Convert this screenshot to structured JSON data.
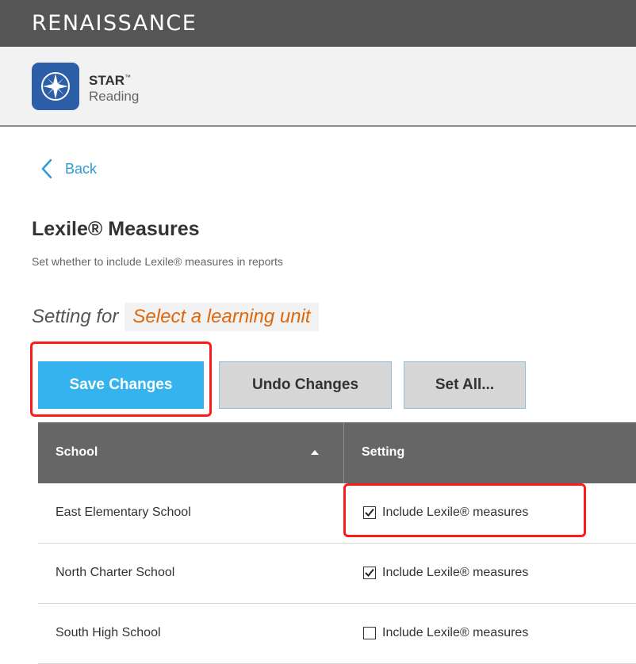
{
  "header": {
    "brand": "RENAISSANCE"
  },
  "app": {
    "name": "STAR",
    "trademark": "™",
    "subtitle": "Reading"
  },
  "nav": {
    "back_label": "Back"
  },
  "page": {
    "title": "Lexile® Measures",
    "description": "Set whether to include Lexile® measures in reports",
    "setting_for_label": "Setting for",
    "learning_unit_placeholder": "Select a learning unit"
  },
  "buttons": {
    "save": "Save Changes",
    "undo": "Undo Changes",
    "set_all": "Set All..."
  },
  "table": {
    "columns": [
      "School",
      "Setting"
    ],
    "sort": "ascending",
    "rows": [
      {
        "school": "East Elementary School",
        "setting_label": "Include Lexile® measures",
        "checked": true
      },
      {
        "school": "North Charter School",
        "setting_label": "Include Lexile® measures",
        "checked": true
      },
      {
        "school": "South High School",
        "setting_label": "Include Lexile® measures",
        "checked": false
      }
    ]
  },
  "colors": {
    "topbar": "#555555",
    "accent_blue": "#35b3ef",
    "link_blue": "#2f9bd6",
    "unit_orange": "#e0670c",
    "highlight_red": "#ff1a1a",
    "table_header": "#666666"
  },
  "icons": [
    "compass-icon",
    "chevron-left-icon",
    "sort-up-icon",
    "checkbox-checked-icon",
    "checkbox-empty-icon"
  ]
}
